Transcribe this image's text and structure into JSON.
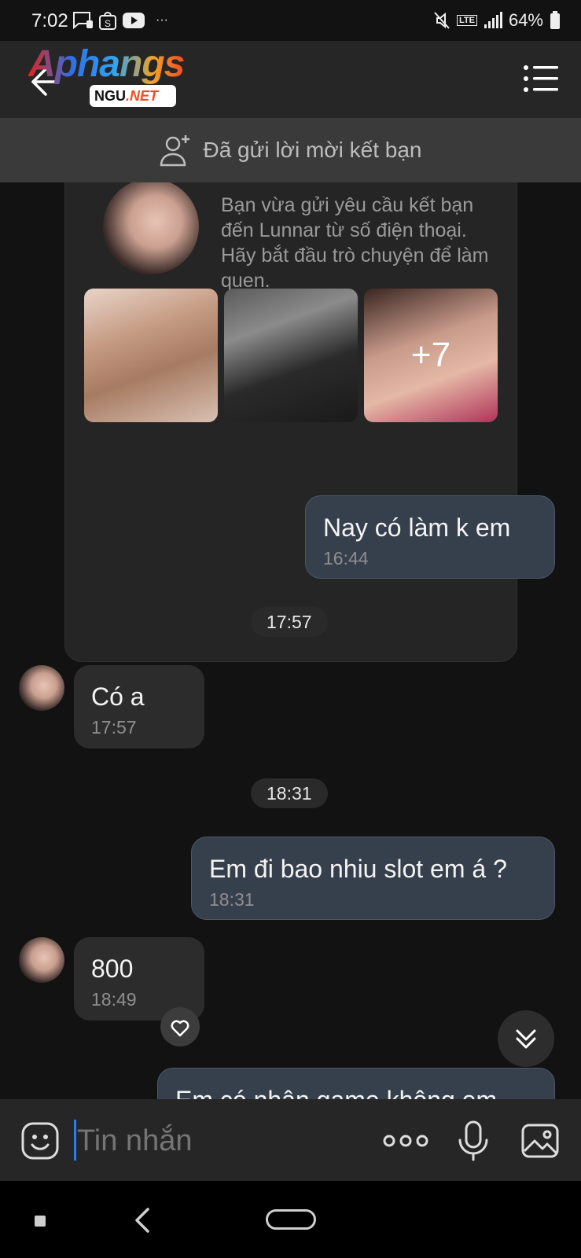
{
  "status_bar": {
    "time": "7:02",
    "battery": "64%",
    "extra": "···",
    "network": "LTE"
  },
  "header": {
    "logo_main": "Aphangs",
    "logo_badge_prefix": "NGU",
    "logo_badge_suffix": ".NET"
  },
  "request_bar": {
    "text": "Đã gửi lời mời kết bạn"
  },
  "profile_card": {
    "name": "Lunnar",
    "description": "Bạn vừa gửi yêu cầu kết bạn đến Lunnar từ số điện thoại. Hãy bắt đầu trò chuyện để làm quen.",
    "more_photos": "+7"
  },
  "messages": [
    {
      "direction": "out",
      "text": "Nay có làm k em",
      "time": "16:44"
    },
    {
      "type": "divider",
      "text": "17:57"
    },
    {
      "direction": "in",
      "text": "Có a",
      "time": "17:57"
    },
    {
      "type": "divider",
      "text": "18:31"
    },
    {
      "direction": "out",
      "text": "Em đi bao nhiu slot em á ?",
      "time": "18:31"
    },
    {
      "direction": "in",
      "text": "800",
      "time": "18:49"
    },
    {
      "direction": "out",
      "text": "Em có nhận game không em",
      "time": ""
    }
  ],
  "input": {
    "placeholder": "Tin nhắn"
  },
  "icons": {
    "back": "arrow-left-icon",
    "menu": "list-menu-icon",
    "add_friend": "add-user-icon",
    "emoji": "emoji-icon",
    "more": "more-dots-icon",
    "mic": "microphone-icon",
    "image": "image-icon",
    "heart": "heart-icon",
    "scroll_down": "double-chevron-down-icon"
  },
  "colors": {
    "background": "#121212",
    "outgoing_bubble": "#363f4c",
    "incoming_bubble": "#2c2c2c",
    "caret": "#2a7bf4"
  }
}
